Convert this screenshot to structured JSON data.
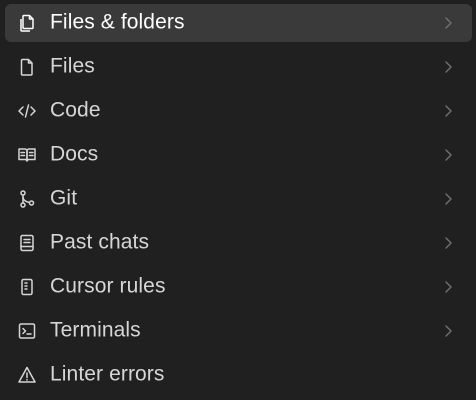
{
  "menu": {
    "items": [
      {
        "label": "Files & folders",
        "icon": "files-folders-icon",
        "has_submenu": true,
        "active": true
      },
      {
        "label": "Files",
        "icon": "file-icon",
        "has_submenu": true,
        "active": false
      },
      {
        "label": "Code",
        "icon": "code-icon",
        "has_submenu": true,
        "active": false
      },
      {
        "label": "Docs",
        "icon": "book-icon",
        "has_submenu": true,
        "active": false
      },
      {
        "label": "Git",
        "icon": "git-branch-icon",
        "has_submenu": true,
        "active": false
      },
      {
        "label": "Past chats",
        "icon": "notebook-icon",
        "has_submenu": true,
        "active": false
      },
      {
        "label": "Cursor rules",
        "icon": "rules-document-icon",
        "has_submenu": true,
        "active": false
      },
      {
        "label": "Terminals",
        "icon": "terminal-icon",
        "has_submenu": true,
        "active": false
      },
      {
        "label": "Linter errors",
        "icon": "warning-triangle-icon",
        "has_submenu": false,
        "active": false
      }
    ]
  },
  "colors": {
    "background": "#202020",
    "active_row": "#3a3a3a",
    "text": "#d6d6d6",
    "active_text": "#ffffff",
    "chevron": "#6e6e6e"
  }
}
